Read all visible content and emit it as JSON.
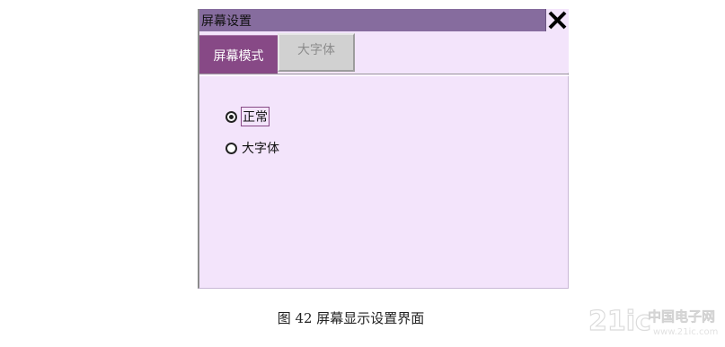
{
  "window": {
    "title": "屏幕设置",
    "close_icon": "close-icon"
  },
  "tabs": [
    {
      "label": "屏幕模式",
      "active": true
    },
    {
      "label": "大字体",
      "active": false
    }
  ],
  "options": [
    {
      "label": "正常",
      "selected": true,
      "focused": true
    },
    {
      "label": "大字体",
      "selected": false,
      "focused": false
    }
  ],
  "caption": "图 42  屏幕显示设置界面",
  "watermark": {
    "text": "21ic中国电子网",
    "domain": "www.21ic.com"
  },
  "colors": {
    "titlebar": "#866c9e",
    "body": "#f3e4fb",
    "tab_active": "#874986",
    "tab_inactive": "#d1d1d1"
  }
}
